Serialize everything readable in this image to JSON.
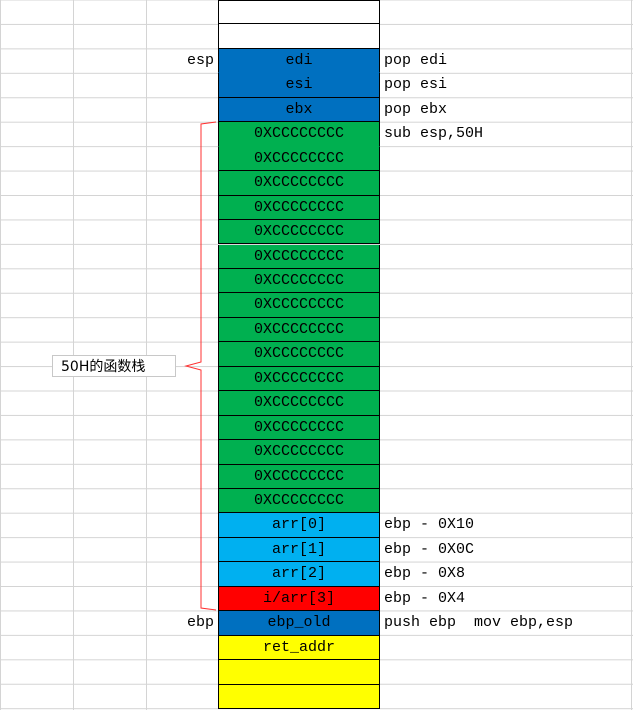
{
  "colors": {
    "blue": "#0070c0",
    "green": "#00b050",
    "light_blue": "#00b0f0",
    "red": "#ff0000",
    "yellow": "#ffff00",
    "white": "#ffffff"
  },
  "stack": [
    {
      "text": "",
      "color": "white"
    },
    {
      "text": "",
      "color": "white"
    },
    {
      "text": "edi",
      "color": "blue",
      "note": "pop edi",
      "left": "esp"
    },
    {
      "text": "esi",
      "color": "blue",
      "note": "pop esi"
    },
    {
      "text": "ebx",
      "color": "blue",
      "note": "pop ebx"
    },
    {
      "text": "0XCCCCCCCC",
      "color": "green",
      "note": "sub esp,50H"
    },
    {
      "text": "0XCCCCCCCC",
      "color": "green"
    },
    {
      "text": "0XCCCCCCCC",
      "color": "green"
    },
    {
      "text": "0XCCCCCCCC",
      "color": "green"
    },
    {
      "text": "0XCCCCCCCC",
      "color": "green"
    },
    {
      "text": "0XCCCCCCCC",
      "color": "green"
    },
    {
      "text": "0XCCCCCCCC",
      "color": "green"
    },
    {
      "text": "0XCCCCCCCC",
      "color": "green"
    },
    {
      "text": "0XCCCCCCCC",
      "color": "green"
    },
    {
      "text": "0XCCCCCCCC",
      "color": "green"
    },
    {
      "text": "0XCCCCCCCC",
      "color": "green"
    },
    {
      "text": "0XCCCCCCCC",
      "color": "green"
    },
    {
      "text": "0XCCCCCCCC",
      "color": "green"
    },
    {
      "text": "0XCCCCCCCC",
      "color": "green"
    },
    {
      "text": "0XCCCCCCCC",
      "color": "green"
    },
    {
      "text": "0XCCCCCCCC",
      "color": "green"
    },
    {
      "text": "arr[0]",
      "color": "light_blue",
      "note": "ebp - 0X10"
    },
    {
      "text": "arr[1]",
      "color": "light_blue",
      "note": "ebp - 0X0C"
    },
    {
      "text": "arr[2]",
      "color": "light_blue",
      "note": "ebp - 0X8"
    },
    {
      "text": "i/arr[3]",
      "color": "red",
      "note": "ebp - 0X4"
    },
    {
      "text": "ebp_old",
      "color": "blue",
      "note": "push ebp  mov ebp,esp",
      "left": "ebp"
    },
    {
      "text": "ret_addr",
      "color": "yellow"
    },
    {
      "text": "",
      "color": "yellow"
    },
    {
      "text": "",
      "color": "yellow"
    }
  ],
  "brace_label": "50H的函数栈"
}
